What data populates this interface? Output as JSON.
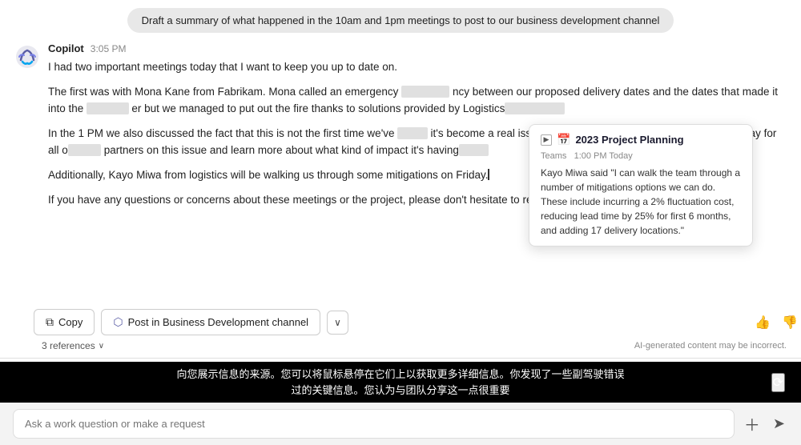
{
  "user_message": {
    "text": "Draft a summary of what happened in the 10am and 1pm meetings to post to our business development channel"
  },
  "copilot": {
    "name": "Copilot",
    "time": "3:05 PM",
    "paragraphs": [
      "I had two important meetings today that I want to keep you up to date on.",
      "The first was with Mona Kane from Fabrikam. Mona called an emergency meeting due to a discrepancy between our proposed delivery dates and the dates that made it into the contract. It was a tough one but we managed to put out the fire thanks to solutions provided by Logistics.",
      "In the 1 PM we also discussed the fact that this is not the first time we've had this issue and that it's become a real issue that's impacting our numbers. The take away for all of us is to stay closer with our partners on this issue and learn more about what kind of impact it's having.",
      "Additionally, Kayo Miwa from logistics will be walking us through some mitigations on Friday.",
      "If you have any questions or concerns about these meetings or the project, please don't hesitate to reach out to me."
    ]
  },
  "tooltip": {
    "title": "2023 Project Planning",
    "source": "Teams",
    "time": "1:00 PM Today",
    "body": "Kayo Miwa said \"I can walk the team through a number of mitigations options we can do. These include incurring a 2% fluctuation cost, reducing lead time by 25% for first 6 months, and adding 17 delivery locations.\""
  },
  "actions": {
    "copy_label": "Copy",
    "post_label": "Post in Business Development channel",
    "chevron": "∨"
  },
  "references": {
    "label": "3 references",
    "chevron": "∨",
    "disclaimer": "AI-generated content may be incorrect."
  },
  "info_bar": {
    "line1": "向您展示信息的来源。您可以将鼠标悬停在它们上以获取更多详细信息。你发现了一些副驾驶错误",
    "line2": "过的关键信息。您认为与团队分享这一点很重要"
  },
  "input": {
    "placeholder": "Ask a work question or make a request"
  },
  "icons": {
    "copilot_color": "#5b5ea6",
    "teams_color": "#5b5ea6"
  }
}
